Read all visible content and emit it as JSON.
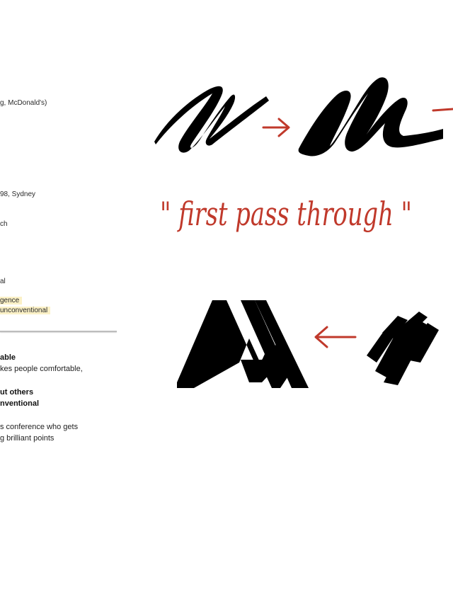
{
  "document": {
    "lines": [
      "g, McDonald's)",
      "98, Sydney",
      "ch",
      "al",
      "gence",
      "unconventional",
      "able",
      "kes people comfortable,",
      "ut others",
      "nventional",
      "s conference who gets",
      "g brilliant points"
    ]
  },
  "handwriting": {
    "caption": "\" first pass through \""
  },
  "colors": {
    "ink": "#000000",
    "annotation_red": "#c0392b",
    "highlight": "#fbf1c7"
  }
}
